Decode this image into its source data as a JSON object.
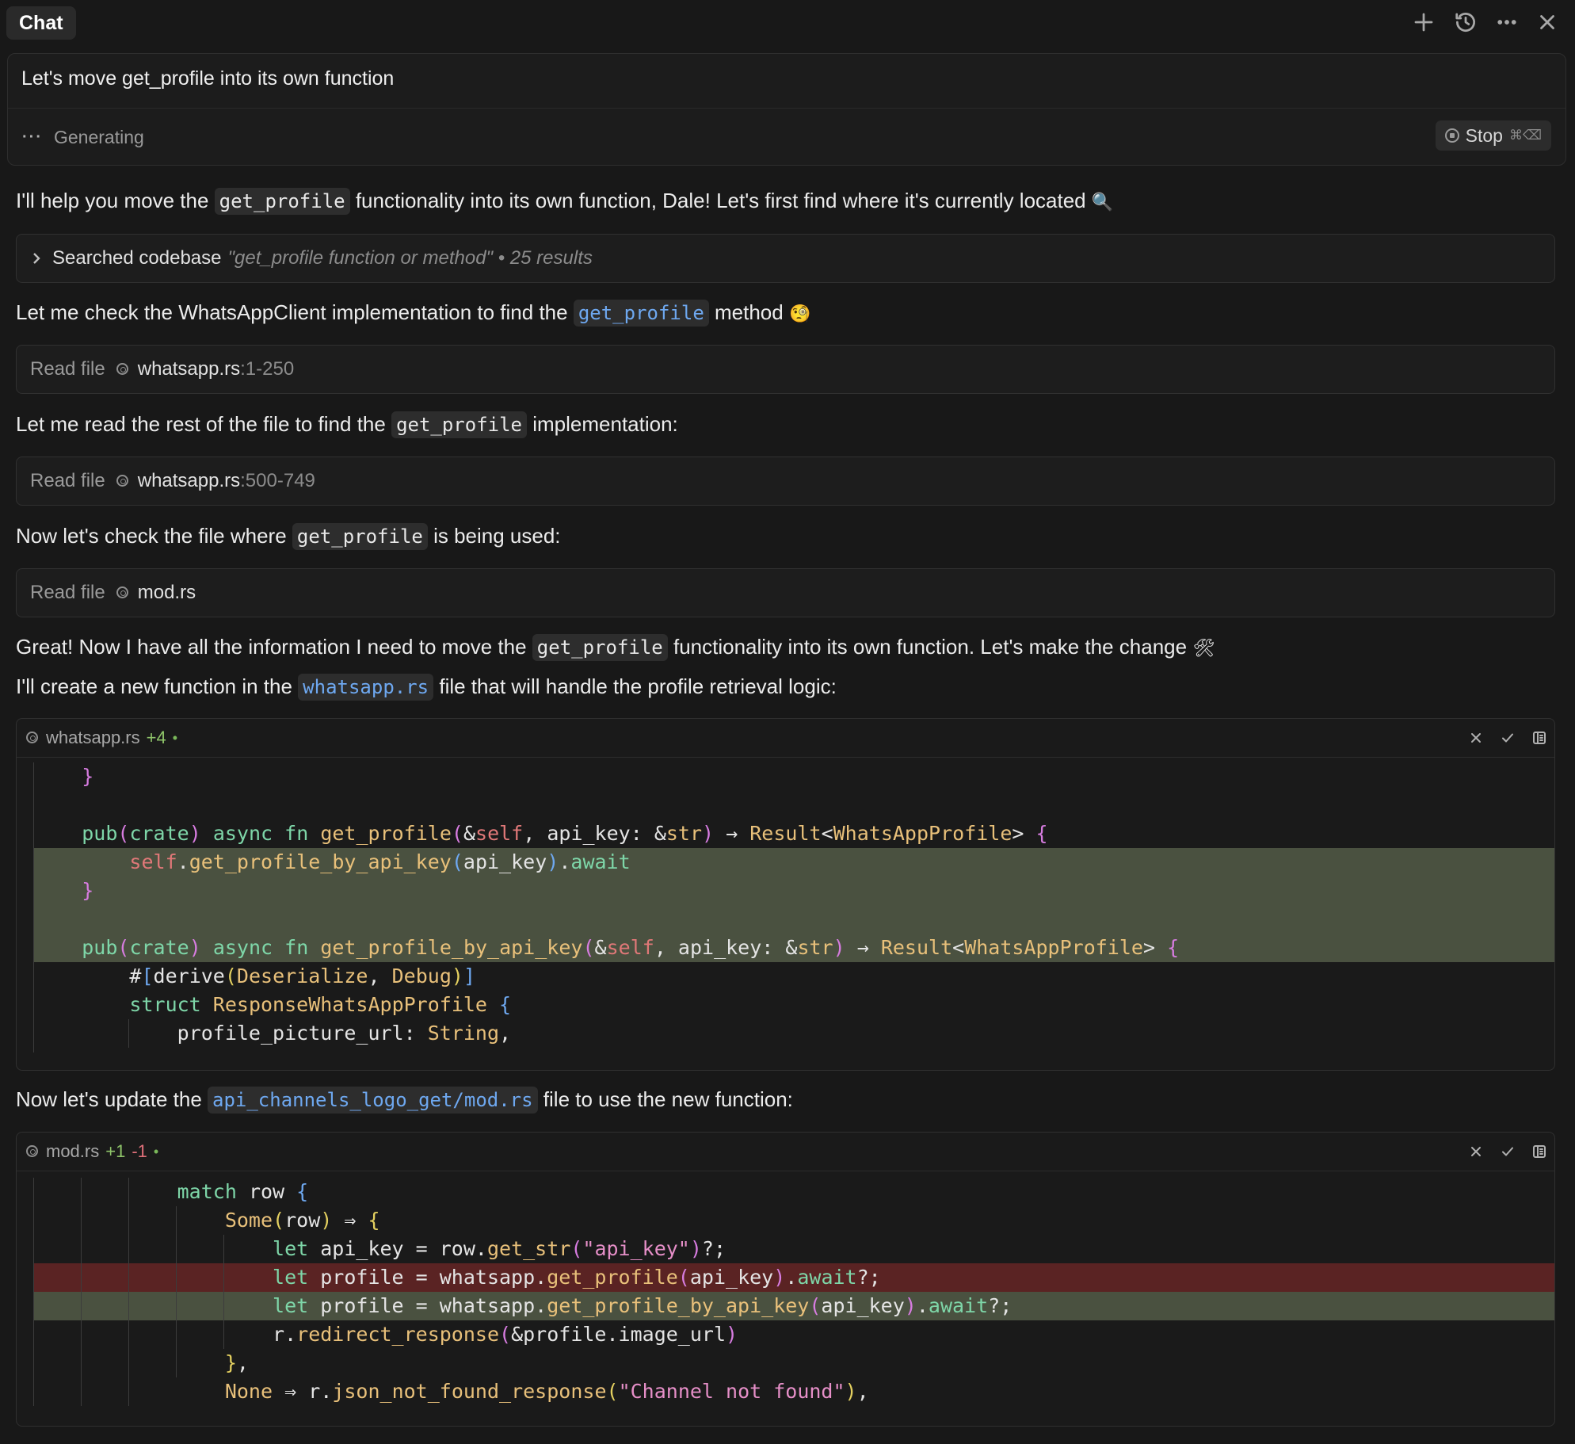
{
  "header": {
    "tab": "Chat"
  },
  "prompt": {
    "text": "Let's move get_profile into its own function",
    "status": "Generating",
    "stop_label": "Stop",
    "stop_shortcut": "⌘⌫"
  },
  "messages": {
    "m1": {
      "before": "I'll help you move the ",
      "code": "get_profile",
      "after": " functionality into its own function, Dale! Let's first find where it's currently located ",
      "emoji": "🔍"
    },
    "search": {
      "label": "Searched codebase",
      "query": "\"get_profile function or method\" • 25 results"
    },
    "m2": {
      "before": "Let me check the WhatsAppClient implementation to find the ",
      "code": "get_profile",
      "after": " method ",
      "emoji": "🧐"
    },
    "read1": {
      "label": "Read file",
      "file": "whatsapp.rs",
      "range": ":1-250"
    },
    "m3": {
      "before": "Let me read the rest of the file to find the ",
      "code": "get_profile",
      "after": " implementation:"
    },
    "read2": {
      "label": "Read file",
      "file": "whatsapp.rs",
      "range": ":500-749"
    },
    "m4": {
      "before": "Now let's check the file where ",
      "code": "get_profile",
      "after": " is being used:"
    },
    "read3": {
      "label": "Read file",
      "file": "mod.rs",
      "range": ""
    },
    "m5": {
      "before": "Great! Now I have all the information I need to move the ",
      "code": "get_profile",
      "after": " functionality into its own function. Let's make the change ",
      "emoji": "🛠"
    },
    "m6": {
      "before": "I'll create a new function in the ",
      "code": "whatsapp.rs",
      "after": " file that will handle the profile retrieval logic:"
    },
    "m7": {
      "before": "Now let's update the ",
      "code": "api_channels_logo_get/mod.rs",
      "after": " file to use the new function:"
    }
  },
  "code_blocks": {
    "whatsapp": {
      "file": "whatsapp.rs",
      "added": "+4",
      "dot": "•"
    },
    "mod": {
      "file": "mod.rs",
      "added": "+1",
      "removed": "-1",
      "dot": "•"
    }
  },
  "code": {
    "w0": "}",
    "w1": [
      [
        "pub",
        "kw"
      ],
      [
        "(",
        "p1"
      ],
      [
        "crate",
        "kw"
      ],
      [
        ")",
        "p1"
      ],
      [
        " ",
        ""
      ],
      [
        "async",
        "kw"
      ],
      [
        " ",
        ""
      ],
      [
        "fn",
        "kw"
      ],
      [
        " ",
        ""
      ],
      [
        "get_profile",
        "fn"
      ],
      [
        "(",
        "p1"
      ],
      [
        "&",
        ""
      ],
      [
        "self",
        "self"
      ],
      [
        ", api_key: &",
        ""
      ],
      [
        "str",
        "ty"
      ],
      [
        ")",
        "p1"
      ],
      [
        " → ",
        ""
      ],
      [
        "Result",
        "ty"
      ],
      [
        "<",
        ""
      ],
      [
        "WhatsAppProfile",
        "ty"
      ],
      [
        "> ",
        ""
      ],
      [
        "{",
        "p1"
      ]
    ],
    "w2": [
      [
        "self",
        "self"
      ],
      [
        ".",
        ""
      ],
      [
        "get_profile_by_api_key",
        "fn"
      ],
      [
        "(",
        "p2"
      ],
      [
        "api_key",
        ""
      ],
      [
        ")",
        "p2"
      ],
      [
        ".",
        ""
      ],
      [
        "await",
        "kw"
      ]
    ],
    "w3": [
      [
        "}",
        "p1"
      ]
    ],
    "w4": [
      [
        "pub",
        "kw"
      ],
      [
        "(",
        "p1"
      ],
      [
        "crate",
        "kw"
      ],
      [
        ")",
        "p1"
      ],
      [
        " ",
        ""
      ],
      [
        "async",
        "kw"
      ],
      [
        " ",
        ""
      ],
      [
        "fn",
        "kw"
      ],
      [
        " ",
        ""
      ],
      [
        "get_profile_by_api_key",
        "fn"
      ],
      [
        "(",
        "p1"
      ],
      [
        "&",
        ""
      ],
      [
        "self",
        "self"
      ],
      [
        ", api_key: &",
        ""
      ],
      [
        "str",
        "ty"
      ],
      [
        ")",
        "p1"
      ],
      [
        " → ",
        ""
      ],
      [
        "Result",
        "ty"
      ],
      [
        "<",
        ""
      ],
      [
        "WhatsAppProfile",
        "ty"
      ],
      [
        "> ",
        ""
      ],
      [
        "{",
        "p1"
      ]
    ],
    "w5": [
      [
        "#",
        ""
      ],
      [
        "[",
        "p2"
      ],
      [
        "derive",
        ""
      ],
      [
        "(",
        "p3"
      ],
      [
        "Deserialize",
        "ty"
      ],
      [
        ", ",
        ""
      ],
      [
        "Debug",
        "ty"
      ],
      [
        ")",
        "p3"
      ],
      [
        "]",
        "p2"
      ]
    ],
    "w6": [
      [
        "struct",
        "kw"
      ],
      [
        " ",
        ""
      ],
      [
        "ResponseWhatsAppProfile",
        "ty"
      ],
      [
        " ",
        ""
      ],
      [
        "{",
        "p2"
      ]
    ],
    "w7": [
      [
        "profile_picture_url: ",
        ""
      ],
      [
        "String",
        "ty"
      ],
      [
        ",",
        ""
      ]
    ],
    "d0": [
      [
        "match",
        "kw"
      ],
      [
        " row ",
        ""
      ],
      [
        "{",
        "p2"
      ]
    ],
    "d1": [
      [
        "Some",
        "ty"
      ],
      [
        "(",
        "p3"
      ],
      [
        "row",
        ""
      ],
      [
        ")",
        "p3"
      ],
      [
        " ⇒ ",
        ""
      ],
      [
        "{",
        "p3"
      ]
    ],
    "d2": [
      [
        "let",
        "kw"
      ],
      [
        " api_key = row.",
        ""
      ],
      [
        "get_str",
        "mc"
      ],
      [
        "(",
        "p1"
      ],
      [
        "\"api_key\"",
        "str"
      ],
      [
        ")",
        "p1"
      ],
      [
        "?;",
        ""
      ]
    ],
    "d3": [
      [
        "let",
        "kw"
      ],
      [
        " profile = whatsapp.",
        ""
      ],
      [
        "get_profile",
        "mc"
      ],
      [
        "(",
        "p1"
      ],
      [
        "api_key",
        ""
      ],
      [
        ")",
        "p1"
      ],
      [
        ".",
        ""
      ],
      [
        "await",
        "kw"
      ],
      [
        "?;",
        ""
      ]
    ],
    "d4": [
      [
        "let",
        "kw"
      ],
      [
        " profile = whatsapp.",
        ""
      ],
      [
        "get_profile_by_api_key",
        "mc"
      ],
      [
        "(",
        "p1"
      ],
      [
        "api_key",
        ""
      ],
      [
        ")",
        "p1"
      ],
      [
        ".",
        ""
      ],
      [
        "await",
        "kw"
      ],
      [
        "?;",
        ""
      ]
    ],
    "d5": [
      [
        "r.",
        ""
      ],
      [
        "redirect_response",
        "mc"
      ],
      [
        "(",
        "p1"
      ],
      [
        "&profile.image_url",
        ""
      ],
      [
        ")",
        "p1"
      ]
    ],
    "d6": [
      [
        "}",
        "p3"
      ],
      [
        ",",
        ""
      ]
    ],
    "d7": [
      [
        "None",
        "ty"
      ],
      [
        " ⇒ r.",
        ""
      ],
      [
        "json_not_found_response",
        "mc"
      ],
      [
        "(",
        "p3"
      ],
      [
        "\"Channel not found\"",
        "str"
      ],
      [
        ")",
        "p3"
      ],
      [
        ",",
        ""
      ]
    ]
  }
}
